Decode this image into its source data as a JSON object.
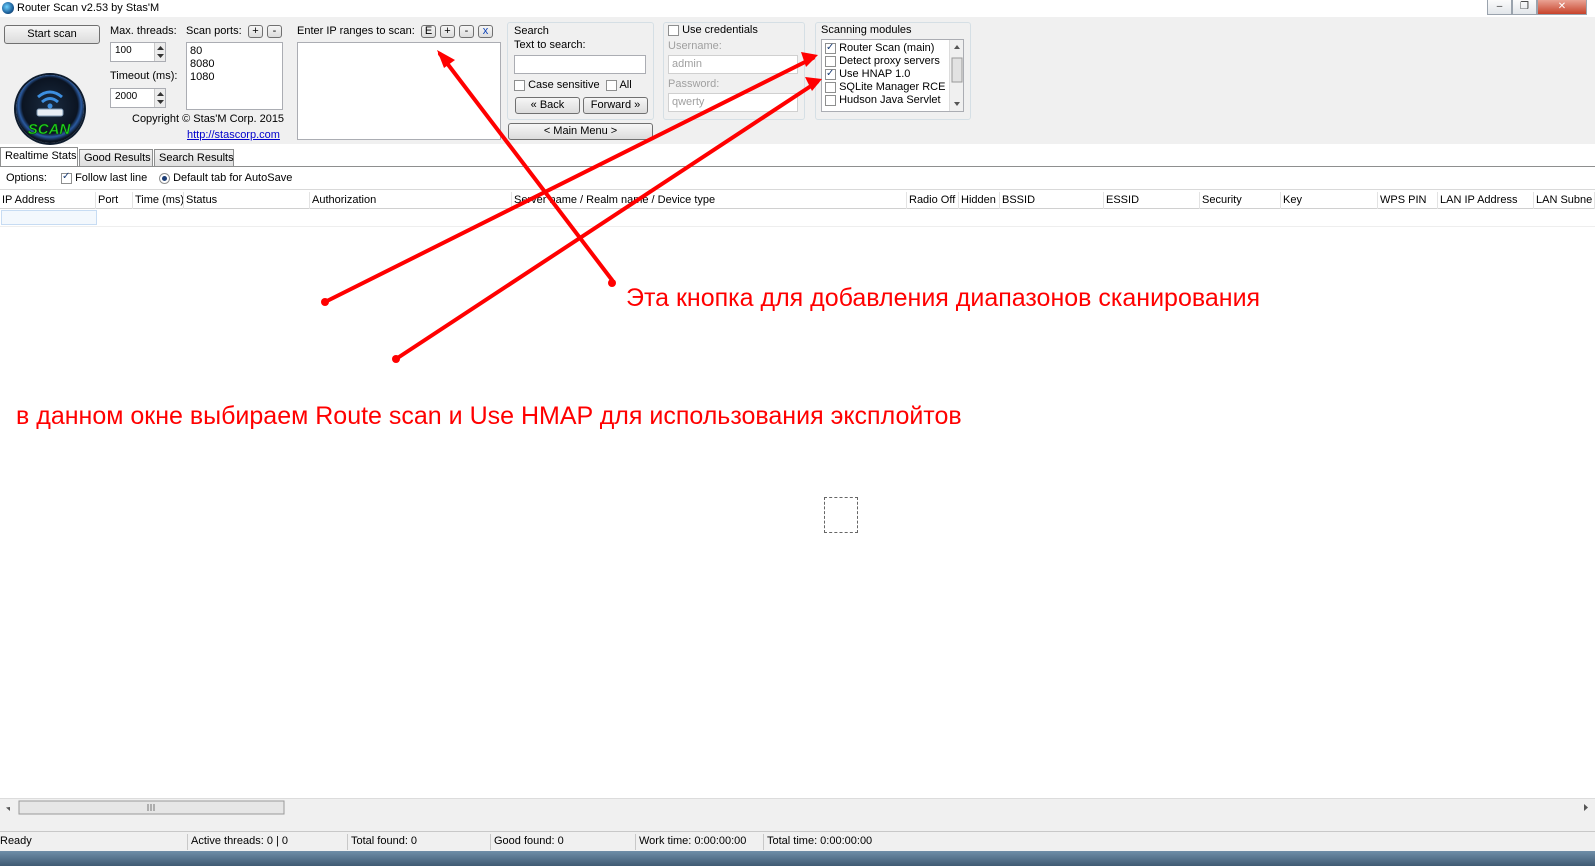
{
  "window": {
    "title": "Router Scan v2.53 by Stas'M"
  },
  "toolbar": {
    "start_scan": "Start scan"
  },
  "threads": {
    "label": "Max. threads:",
    "value": "100"
  },
  "timeout": {
    "label": "Timeout (ms):",
    "value": "2000"
  },
  "ports": {
    "label": "Scan ports:",
    "add": "+",
    "remove": "-",
    "items": [
      "80",
      "8080",
      "1080"
    ]
  },
  "copyright": {
    "text": "Copyright © Stas'M Corp. 2015",
    "link": "http://stascorp.com"
  },
  "ip_ranges": {
    "label": "Enter IP ranges to scan:",
    "buttons": [
      "E",
      "+",
      "-",
      "x"
    ]
  },
  "search": {
    "title": "Search",
    "text_label": "Text to search:",
    "case_sensitive": "Case sensitive",
    "all": "All",
    "back": "« Back",
    "forward": "Forward »",
    "main_menu": "< Main Menu >"
  },
  "credentials": {
    "label": "Use credentials",
    "username_label": "Username:",
    "username_value": "admin",
    "password_label": "Password:",
    "password_value": "qwerty"
  },
  "modules": {
    "label": "Scanning modules",
    "items": [
      {
        "label": "Router Scan (main)",
        "checked": true
      },
      {
        "label": "Detect proxy servers",
        "checked": false
      },
      {
        "label": "Use HNAP 1.0",
        "checked": true
      },
      {
        "label": "SQLite Manager RCE",
        "checked": false
      },
      {
        "label": "Hudson Java Servlet",
        "checked": false
      }
    ]
  },
  "tabs": [
    "Realtime Stats",
    "Good Results",
    "Search Results"
  ],
  "options": {
    "label": "Options:",
    "follow": "Follow last line",
    "autosave": "Default tab for AutoSave"
  },
  "columns": [
    "IP Address",
    "Port",
    "Time (ms)",
    "Status",
    "Authorization",
    "Server name / Realm name / Device type",
    "Radio Off",
    "Hidden",
    "BSSID",
    "ESSID",
    "Security",
    "Key",
    "WPS PIN",
    "LAN IP Address",
    "LAN Subne"
  ],
  "status": {
    "ready": "Ready",
    "active": "Active threads: 0 | 0",
    "total_found": "Total found: 0",
    "good_found": "Good found: 0",
    "work_time": "Work time: 0:00:00:00",
    "total_time": "Total time: 0:00:00:00"
  },
  "annotations": {
    "button_note": "Эта кнопка для добавления диапазонов сканирования",
    "modules_note": "в данном окне выбираем Route scan и Use HMAP для использования эксплойтов",
    "color": "#ff0000"
  }
}
